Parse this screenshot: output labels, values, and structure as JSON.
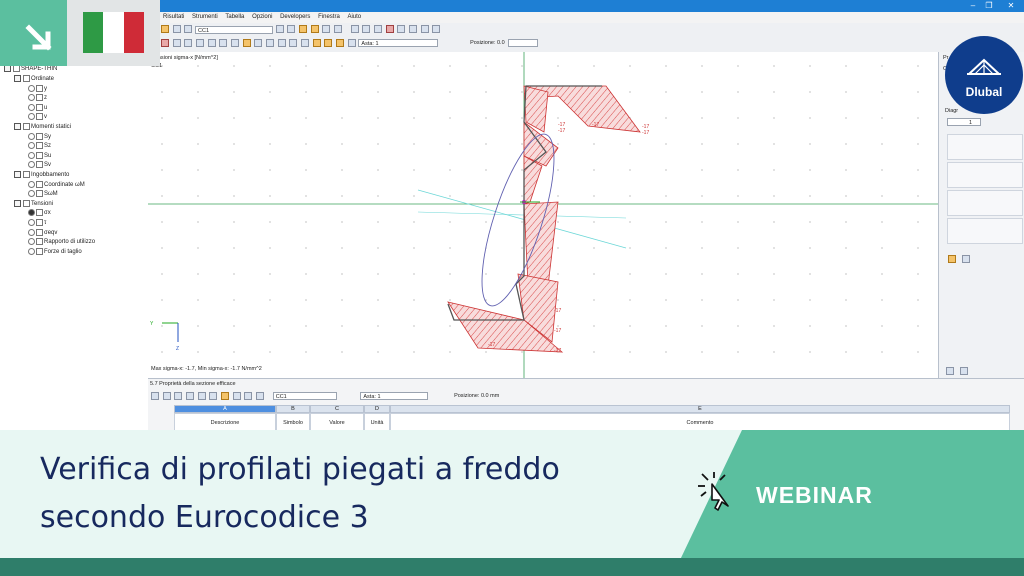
{
  "window": {
    "controls": [
      "–",
      "❐",
      "✕"
    ]
  },
  "menu": [
    "Risultati",
    "Strumenti",
    "Tabella",
    "Opzioni",
    "Developers",
    "Finestra",
    "Aiuto"
  ],
  "toolbar1": {
    "case": "CC1"
  },
  "toolbar2": {
    "asta_label": "Asta: 1",
    "posizione_label": "Posizione: 0.0"
  },
  "tree": {
    "root": "SHAPE-THIN",
    "groups": [
      {
        "label": "Ordinate",
        "items": [
          {
            "label": "y",
            "selected": false
          },
          {
            "label": "z",
            "selected": false
          },
          {
            "label": "u",
            "selected": false
          },
          {
            "label": "v",
            "selected": false
          }
        ]
      },
      {
        "label": "Momenti statici",
        "items": [
          {
            "label": "Sy",
            "selected": false
          },
          {
            "label": "Sz",
            "selected": false
          },
          {
            "label": "Su",
            "selected": false
          },
          {
            "label": "Sv",
            "selected": false
          }
        ]
      },
      {
        "label": "Ingobbamento",
        "items": [
          {
            "label": "Coordinate ωM",
            "selected": false
          },
          {
            "label": "SωM",
            "selected": false
          }
        ]
      },
      {
        "label": "Tensioni",
        "items": [
          {
            "label": "σx",
            "selected": true
          },
          {
            "label": "τ",
            "selected": false
          },
          {
            "label": "σeqv",
            "selected": false
          },
          {
            "label": "Rapporto di utilizzo",
            "selected": false
          },
          {
            "label": "Forze di taglio",
            "selected": false
          }
        ]
      }
    ]
  },
  "graphic": {
    "header": "Tensioni sigma-x [N/mm^2]",
    "case": "CC1",
    "footer": "Max sigma-x: -1.7, Min sigma-x: -1.7 N/mm^2",
    "value_label": "-17",
    "axis_y": "Y",
    "axis_z": "Z"
  },
  "rightpanel": {
    "header": "Pr",
    "cb": "C",
    "diag_label": "Diagr",
    "diag_value": "1"
  },
  "table": {
    "title": "5.7 Proprietà della sezione efficace",
    "case": "CC1",
    "asta": "Asta: 1",
    "posizione": "Posizione: 0.0 mm",
    "columns": [
      {
        "letter": "A",
        "name": "Descrizione"
      },
      {
        "letter": "B",
        "name": "Simbolo"
      },
      {
        "letter": "C",
        "name": "Valore"
      },
      {
        "letter": "D",
        "name": "Unità"
      },
      {
        "letter": "E",
        "name": "Commento"
      }
    ]
  },
  "logo": {
    "text": "Dlubal"
  },
  "banner": {
    "title_line1": "Verifica di profilati piegati a freddo",
    "title_line2": "secondo Eurocodice 3",
    "tag": "WEBINAR"
  },
  "colors": {
    "accent_green": "#5bbf9f",
    "dark_green": "#2f7e6a",
    "navy": "#17295e",
    "logo_blue": "#0f3d8c",
    "flag_green": "#2e9a45",
    "flag_red": "#cf2b37"
  }
}
